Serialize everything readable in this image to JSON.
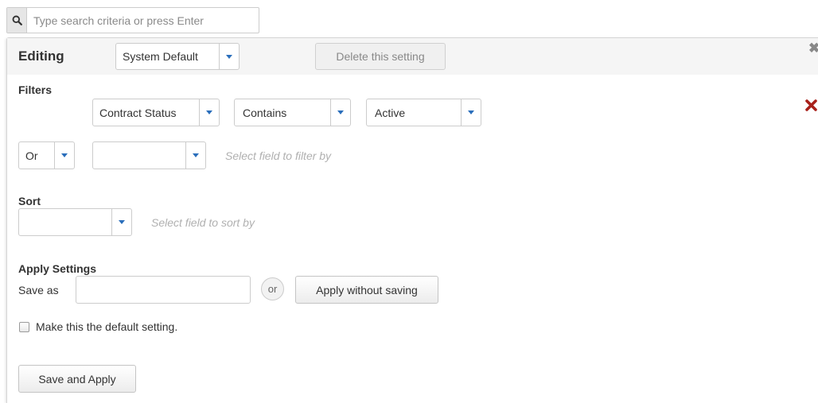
{
  "search": {
    "placeholder": "Type search criteria or press Enter",
    "icon": "search-icon"
  },
  "panel": {
    "editing_label": "Editing",
    "setting_select": "System Default",
    "delete_label": "Delete this setting",
    "close_glyph": "✖"
  },
  "filters": {
    "title": "Filters",
    "rows": [
      {
        "field": "Contract Status",
        "operator": "Contains",
        "value": "Active"
      }
    ],
    "new_row": {
      "conjunction": "Or",
      "field": "",
      "hint": "Select field to filter by"
    },
    "remove_color": "#a8201a"
  },
  "sort": {
    "title": "Sort",
    "field": "",
    "hint": "Select field to sort by"
  },
  "apply": {
    "title": "Apply Settings",
    "save_as_label": "Save as",
    "save_as_value": "",
    "or_label": "or",
    "apply_without_saving_label": "Apply without saving",
    "default_checkbox_label": "Make this the default setting.",
    "default_checked": false,
    "save_and_apply_label": "Save and Apply"
  },
  "colors": {
    "caret": "#2a6ebb",
    "panel_header_bg": "#f5f5f5"
  }
}
